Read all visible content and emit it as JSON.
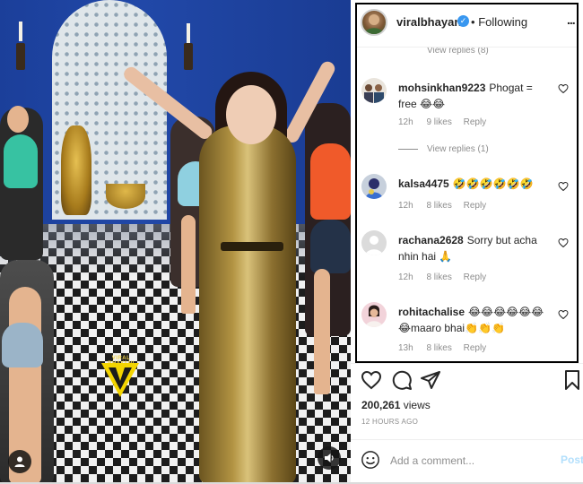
{
  "post": {
    "username": "viralbhayani",
    "verified_mark": "✓",
    "separator": "•",
    "follow_status": "Following",
    "more_label": "...",
    "views_count": "200,261",
    "views_label": "views",
    "time_ago": "12 HOURS AGO",
    "add_comment_placeholder": "Add a comment...",
    "post_label": "Post"
  },
  "video": {
    "watermark_text": "VIRAL BHAYANI",
    "icons": [
      "user-tag-icon",
      "volume-icon"
    ]
  },
  "comments_top": {
    "view_replies_partial": "View replies (8)"
  },
  "comments": [
    {
      "username": "mohsinkhan9223",
      "text": "Phogat = free 😂😂",
      "time": "12h",
      "likes": "9 likes",
      "reply_label": "Reply",
      "view_replies": "View replies (1)"
    },
    {
      "username": "kalsa4475",
      "text": "🤣🤣🤣🤣🤣🤣",
      "time": "12h",
      "likes": "8 likes",
      "reply_label": "Reply"
    },
    {
      "username": "rachana2628",
      "text": "Sorry but acha nhin hai 🙏",
      "time": "12h",
      "likes": "8 likes",
      "reply_label": "Reply"
    },
    {
      "username": "rohitachalise",
      "text": "😂😂😂😂😂😂😂maaro bhai👏👏👏",
      "time": "13h",
      "likes": "8 likes",
      "reply_label": "Reply"
    }
  ],
  "colors": {
    "accent_blue": "#3897f0",
    "post_disabled": "#b2dffc",
    "meta_gray": "#8e8e8e",
    "text": "#262626",
    "frame": "#000000"
  }
}
